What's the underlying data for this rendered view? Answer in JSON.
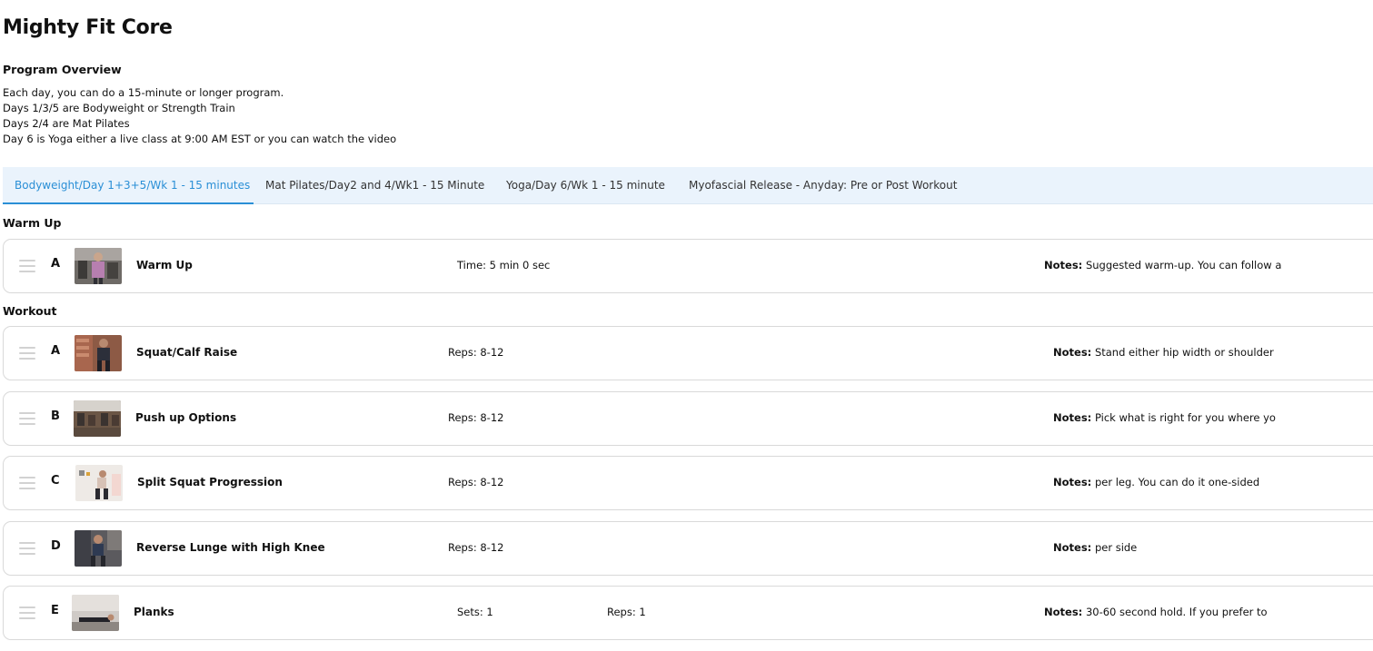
{
  "page": {
    "title": "Mighty Fit Core",
    "overview_heading": "Program Overview",
    "overview_lines": [
      "Each day, you can do a 15-minute or longer program.",
      "Days 1/3/5 are Bodyweight or Strength Train",
      "Days 2/4 are Mat Pilates",
      "Day 6 is Yoga either a live class at 9:00 AM EST or you can watch the video"
    ]
  },
  "tabs": [
    {
      "label": "Bodyweight/Day 1+3+5/Wk 1 - 15 minutes",
      "active": true
    },
    {
      "label": "Mat Pilates/Day2 and 4/Wk1 - 15 Minute",
      "active": false
    },
    {
      "label": "Yoga/Day 6/Wk 1 - 15 minute",
      "active": false
    },
    {
      "label": "Myofascial Release - Anyday: Pre or Post Workout",
      "active": false
    }
  ],
  "sections": {
    "warmup": {
      "label": "Warm Up",
      "rows": [
        {
          "letter": "A",
          "name": "Warm Up",
          "metric": "Time: 5 min 0 sec",
          "notes_label": "Notes:",
          "notes": "Suggested warm-up. You can follow a"
        }
      ]
    },
    "workout": {
      "label": "Workout",
      "rows": [
        {
          "letter": "A",
          "name": "Squat/Calf Raise",
          "metric": "Reps: 8-12",
          "notes_label": "Notes:",
          "notes": "Stand either hip width or shoulder"
        },
        {
          "letter": "B",
          "name": "Push up Options",
          "metric": "Reps: 8-12",
          "notes_label": "Notes:",
          "notes": "Pick what is right for you where yo"
        },
        {
          "letter": "C",
          "name": "Split Squat Progression",
          "metric": "Reps: 8-12",
          "notes_label": "Notes:",
          "notes": "per leg. You can do it one-sided"
        },
        {
          "letter": "D",
          "name": "Reverse Lunge with High Knee",
          "metric": "Reps: 8-12",
          "notes_label": "Notes:",
          "notes": "per side"
        },
        {
          "letter": "E",
          "name": "Planks",
          "metric": "Sets: 1",
          "metric2": "Reps: 1",
          "notes_label": "Notes:",
          "notes": "30-60 second hold. If you prefer to"
        }
      ]
    }
  },
  "icons": {
    "drag_handle": "drag-handle-icon",
    "thumbnail": "exercise-video-thumbnail"
  },
  "colors": {
    "accent": "#2a8fd6",
    "tab_bar_bg": "#eaf3fc",
    "row_border": "#d9d9d9"
  }
}
